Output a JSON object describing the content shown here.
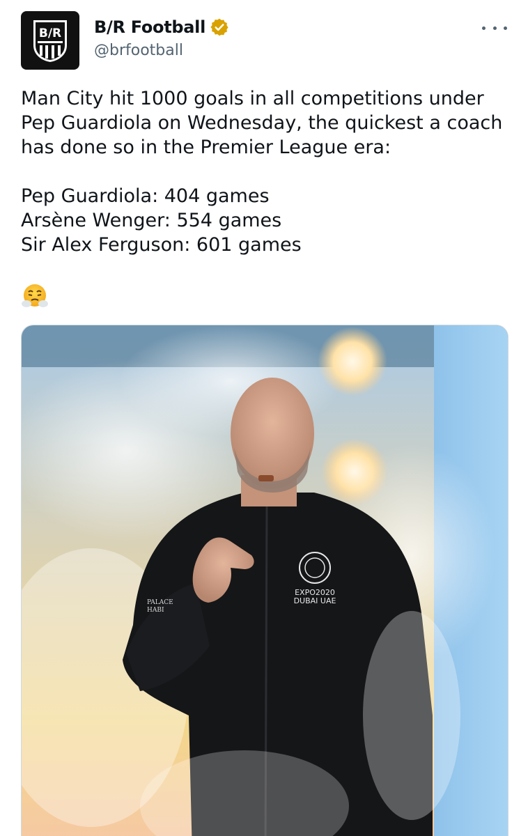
{
  "author": {
    "display_name": "B/R Football",
    "handle": "@brfootball",
    "logo_text": "B/R",
    "avatar_icon": "br-logo-icon",
    "verified_icon": "verified-gold-badge-icon",
    "verified_color": "#d9a200"
  },
  "menu_icon": "more-options-icon",
  "tweet": {
    "lines": [
      "Man City hit 1000 goals in all competitions under",
      "Pep Guardiola on Wednesday, the quickest a coach",
      "has done so in the Premier League era:"
    ],
    "stats": [
      "Pep Guardiola: 404 games",
      "Arsène Wenger: 554 games",
      "Sir Alex Ferguson: 601 games"
    ],
    "emoji_icon": "face-with-steam-from-nose-emoji"
  },
  "media": {
    "image_icon": "photo-man-in-smoke",
    "jacket_text": [
      "EXPO2020",
      "DUBAI UAE"
    ],
    "sleeve_text": [
      "PALACE",
      "HABI"
    ]
  }
}
